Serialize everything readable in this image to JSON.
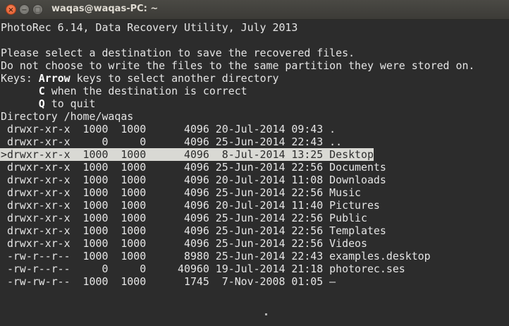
{
  "window": {
    "title": "waqas@waqas-PC: ~",
    "close_glyph": "×",
    "minimize_glyph": "−",
    "maximize_glyph": "□"
  },
  "terminal": {
    "header": "PhotoRec 6.14, Data Recovery Utility, July 2013",
    "prompt_line1": "Please select a destination to save the recovered files.",
    "prompt_line2": "Do not choose to write the files to the same partition they were stored on.",
    "keys_label": "Keys: ",
    "key_arrow": "Arrow",
    "key_arrow_desc": " keys to select another directory",
    "key_c_indent": "      ",
    "key_c": "C",
    "key_c_desc": " when the destination is correct",
    "key_q_indent": "      ",
    "key_q": "Q",
    "key_q_desc": " to quit",
    "directory_line": "Directory /home/waqas",
    "entries": [
      " drwxr-xr-x  1000  1000      4096 20-Jul-2014 09:43 .",
      " drwxr-xr-x     0     0      4096 25-Jun-2014 22:43 ..",
      ">drwxr-xr-x  1000  1000      4096  8-Jul-2014 13:25 Desktop",
      " drwxr-xr-x  1000  1000      4096 25-Jun-2014 22:56 Documents",
      " drwxr-xr-x  1000  1000      4096 20-Jul-2014 11:08 Downloads",
      " drwxr-xr-x  1000  1000      4096 25-Jun-2014 22:56 Music",
      " drwxr-xr-x  1000  1000      4096 20-Jul-2014 11:40 Pictures",
      " drwxr-xr-x  1000  1000      4096 25-Jun-2014 22:56 Public",
      " drwxr-xr-x  1000  1000      4096 25-Jun-2014 22:56 Templates",
      " drwxr-xr-x  1000  1000      4096 25-Jun-2014 22:56 Videos",
      " -rw-r--r--  1000  1000      8980 25-Jun-2014 22:43 examples.desktop",
      " -rw-r--r--     0     0     40960 19-Jul-2014 21:18 photorec.ses",
      " -rw-rw-r--  1000  1000      1745  7-Nov-2008 01:05 –"
    ],
    "selected_index": 2
  }
}
